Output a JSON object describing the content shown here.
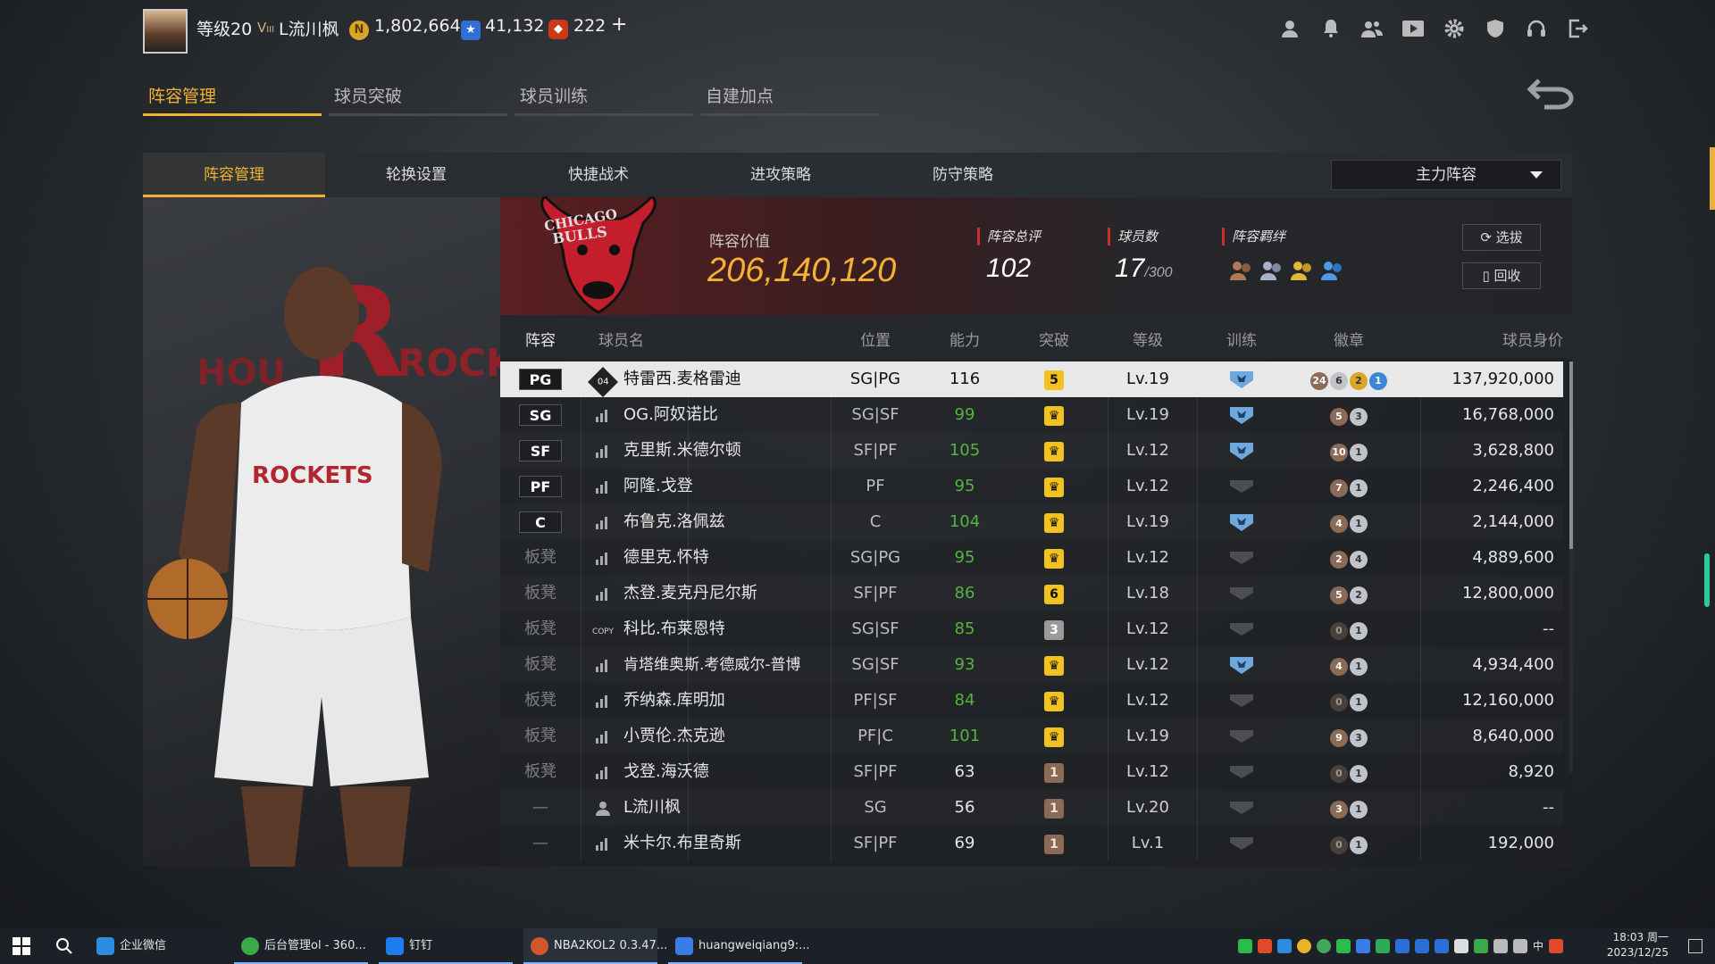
{
  "topbar": {
    "level": "等级20",
    "rank_prefix": "V",
    "rank_sub": "III",
    "player_name": "L流川枫",
    "coins": "1,802,664",
    "coin_icon": "N",
    "stars": "41,132",
    "tokens": "222",
    "plus": "+"
  },
  "main_tabs": [
    {
      "label": "阵容管理"
    },
    {
      "label": "球员突破"
    },
    {
      "label": "球员训练"
    },
    {
      "label": "自建加点"
    }
  ],
  "sub_tabs": [
    {
      "label": "阵容管理"
    },
    {
      "label": "轮换设置"
    },
    {
      "label": "快捷战术"
    },
    {
      "label": "进攻策略"
    },
    {
      "label": "防守策略"
    }
  ],
  "lineup_select": {
    "value": "主力阵容"
  },
  "summary": {
    "value_label": "阵容价值",
    "value": "206,140,120",
    "rating_label": "阵容总评",
    "rating": "102",
    "count_label": "球员数",
    "count": "17",
    "count_max": "/300",
    "bond_label": "阵容羁绊",
    "draft_button": "选拔",
    "recycle_button": "回收"
  },
  "art": {
    "team_text": "HOU",
    "team_letter": "R",
    "team_text2": "ROCK",
    "jersey": "ROCKETS"
  },
  "table": {
    "headers": {
      "lineup": "阵容",
      "name": "球员名",
      "position": "位置",
      "ability": "能力",
      "breakthrough": "突破",
      "level": "等级",
      "training": "训练",
      "badges": "徽章",
      "price": "球员身价"
    },
    "rows": [
      {
        "slot": "PG",
        "slot_type": "starter",
        "icon": "04",
        "name": "特雷西.麦格雷迪",
        "position": "SG|PG",
        "ability": "116",
        "ability_color": "white",
        "break": "5",
        "break_style": "gold",
        "level": "Lv.19",
        "trained": true,
        "badges": [
          "24",
          "6",
          "2",
          "1"
        ],
        "badge_colors": [
          "brown",
          "silver",
          "gold",
          "blue"
        ],
        "price": "137,920,000",
        "selected": true
      },
      {
        "slot": "SG",
        "slot_type": "starter",
        "icon": "signal",
        "name": "OG.阿奴诺比",
        "position": "SG|SF",
        "ability": "99",
        "ability_color": "green",
        "break": "crown",
        "break_style": "gold",
        "level": "Lv.19",
        "trained": true,
        "badges": [
          "5",
          "3"
        ],
        "badge_colors": [
          "brown",
          "silver"
        ],
        "price": "16,768,000"
      },
      {
        "slot": "SF",
        "slot_type": "starter",
        "icon": "signal",
        "name": "克里斯.米德尔顿",
        "position": "SF|PF",
        "ability": "105",
        "ability_color": "green",
        "break": "crown",
        "break_style": "gold",
        "level": "Lv.12",
        "trained": true,
        "badges": [
          "10",
          "1"
        ],
        "badge_colors": [
          "brown",
          "silver"
        ],
        "price": "3,628,800"
      },
      {
        "slot": "PF",
        "slot_type": "starter",
        "icon": "signal",
        "name": "阿隆.戈登",
        "position": "PF",
        "ability": "95",
        "ability_color": "green",
        "break": "crown",
        "break_style": "gold",
        "level": "Lv.12",
        "trained": false,
        "badges": [
          "7",
          "1"
        ],
        "badge_colors": [
          "brown",
          "silver"
        ],
        "price": "2,246,400"
      },
      {
        "slot": "C",
        "slot_type": "starter",
        "icon": "signal",
        "name": "布鲁克.洛佩兹",
        "position": "C",
        "ability": "104",
        "ability_color": "green",
        "break": "crown",
        "break_style": "gold",
        "level": "Lv.19",
        "trained": true,
        "badges": [
          "4",
          "1"
        ],
        "badge_colors": [
          "brown",
          "silver"
        ],
        "price": "2,144,000"
      },
      {
        "slot": "板凳",
        "slot_type": "bench",
        "icon": "signal",
        "name": "德里克.怀特",
        "position": "SG|PG",
        "ability": "95",
        "ability_color": "green",
        "break": "crown",
        "break_style": "gold",
        "level": "Lv.12",
        "trained": false,
        "badges": [
          "2",
          "4"
        ],
        "badge_colors": [
          "brown",
          "silver"
        ],
        "price": "4,889,600"
      },
      {
        "slot": "板凳",
        "slot_type": "bench",
        "icon": "signal",
        "name": "杰登.麦克丹尼尔斯",
        "position": "SF|PF",
        "ability": "86",
        "ability_color": "green",
        "break": "6",
        "break_style": "gold",
        "level": "Lv.18",
        "trained": false,
        "badges": [
          "5",
          "2"
        ],
        "badge_colors": [
          "brown",
          "silver"
        ],
        "price": "12,800,000"
      },
      {
        "slot": "板凳",
        "slot_type": "bench",
        "icon": "COPY",
        "name": "科比.布莱恩特",
        "position": "SG|SF",
        "ability": "85",
        "ability_color": "green",
        "break": "3",
        "break_style": "gray",
        "level": "Lv.12",
        "trained": false,
        "badges": [
          "0",
          "1"
        ],
        "badge_colors": [
          "dark",
          "silver"
        ],
        "price": "--"
      },
      {
        "slot": "板凳",
        "slot_type": "bench",
        "icon": "signal",
        "name": "肯塔维奥斯.考德威尔-普博",
        "position": "SG|SF",
        "ability": "93",
        "ability_color": "green",
        "break": "crown",
        "break_style": "gold",
        "level": "Lv.12",
        "trained": true,
        "badges": [
          "4",
          "1"
        ],
        "badge_colors": [
          "brown",
          "silver"
        ],
        "price": "4,934,400"
      },
      {
        "slot": "板凳",
        "slot_type": "bench",
        "icon": "signal",
        "name": "乔纳森.库明加",
        "position": "PF|SF",
        "ability": "84",
        "ability_color": "green",
        "break": "crown",
        "break_style": "gold",
        "level": "Lv.12",
        "trained": false,
        "badges": [
          "0",
          "1"
        ],
        "badge_colors": [
          "dark",
          "silver"
        ],
        "price": "12,160,000"
      },
      {
        "slot": "板凳",
        "slot_type": "bench",
        "icon": "signal",
        "name": "小贾伦.杰克逊",
        "position": "PF|C",
        "ability": "101",
        "ability_color": "green",
        "break": "crown",
        "break_style": "gold",
        "level": "Lv.19",
        "trained": false,
        "badges": [
          "9",
          "3"
        ],
        "badge_colors": [
          "brown",
          "silver"
        ],
        "price": "8,640,000"
      },
      {
        "slot": "板凳",
        "slot_type": "bench",
        "icon": "signal",
        "name": "戈登.海沃德",
        "position": "SF|PF",
        "ability": "63",
        "ability_color": "white",
        "break": "1",
        "break_style": "brown",
        "level": "Lv.12",
        "trained": false,
        "badges": [
          "0",
          "1"
        ],
        "badge_colors": [
          "dark",
          "silver"
        ],
        "price": "8,920"
      },
      {
        "slot": "—",
        "slot_type": "none",
        "icon": "user",
        "name": "L流川枫",
        "position": "SG",
        "ability": "56",
        "ability_color": "white",
        "break": "1",
        "break_style": "brown",
        "level": "Lv.20",
        "trained": false,
        "badges": [
          "3",
          "1"
        ],
        "badge_colors": [
          "brown",
          "silver"
        ],
        "price": "--"
      },
      {
        "slot": "—",
        "slot_type": "none",
        "icon": "signal",
        "name": "米卡尔.布里奇斯",
        "position": "SF|PF",
        "ability": "69",
        "ability_color": "white",
        "break": "1",
        "break_style": "brown",
        "level": "Lv.1",
        "trained": false,
        "badges": [
          "0",
          "1"
        ],
        "badge_colors": [
          "dark",
          "silver"
        ],
        "price": "192,000"
      }
    ]
  },
  "taskbar": {
    "items": [
      {
        "label": "企业微信"
      },
      {
        "label": "后台管理ol - 360..."
      },
      {
        "label": "钉钉"
      },
      {
        "label": "NBA2KOL2 0.3.47..."
      },
      {
        "label": "huangweiqiang9:..."
      }
    ],
    "ime": "中",
    "clock_time": "18:03 周一",
    "clock_date": "2023/12/25"
  },
  "colors": {
    "accent": "#f2b233",
    "green": "#55b341",
    "red": "#d12c2c"
  }
}
